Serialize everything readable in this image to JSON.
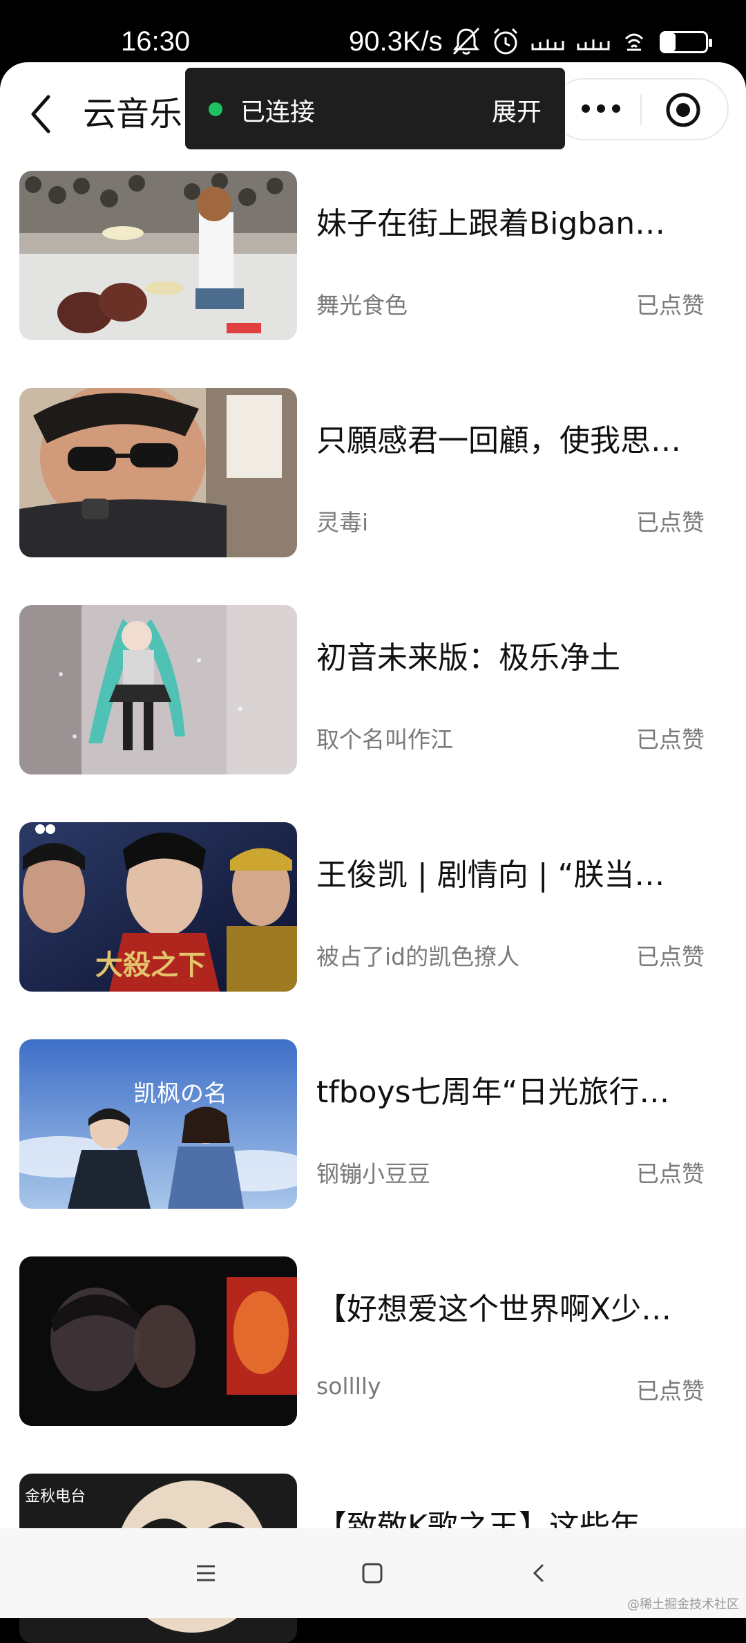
{
  "status_bar": {
    "time": "16:30",
    "network_speed": "90.3K/s",
    "battery_level": "31",
    "battery_fraction": 0.31
  },
  "nav": {
    "title": "云音乐"
  },
  "toast": {
    "status": "已连接",
    "expand": "展开",
    "status_color": "#1ec15f"
  },
  "items": [
    {
      "title": "妹子在街上跟着Bigbang…",
      "author": "舞光食色",
      "liked": "已点赞"
    },
    {
      "title": "只願感君一回顧，使我思…",
      "author": "灵毒i",
      "liked": "已点赞"
    },
    {
      "title": "初音未来版：极乐净土",
      "author": "取个名叫作江",
      "liked": "已点赞"
    },
    {
      "title": "王俊凯 | 剧情向 | “朕当这…",
      "author": "被占了id的凯色撩人",
      "liked": "已点赞"
    },
    {
      "title": "tfboys七周年“日光旅行…",
      "author": "钢镚小豆豆",
      "liked": "已点赞"
    },
    {
      "title": "【好想爱这个世界啊X少年…",
      "author": "solllly",
      "liked": "已点赞"
    },
    {
      "title": "【致敬K歌之王】这些年TF…",
      "author": "",
      "liked": ""
    }
  ],
  "thumb_text": {
    "t4": "大殺之下",
    "t5": "凯枫の名",
    "t7": "金秋电台"
  },
  "watermark": "@稀土掘金技术社区"
}
